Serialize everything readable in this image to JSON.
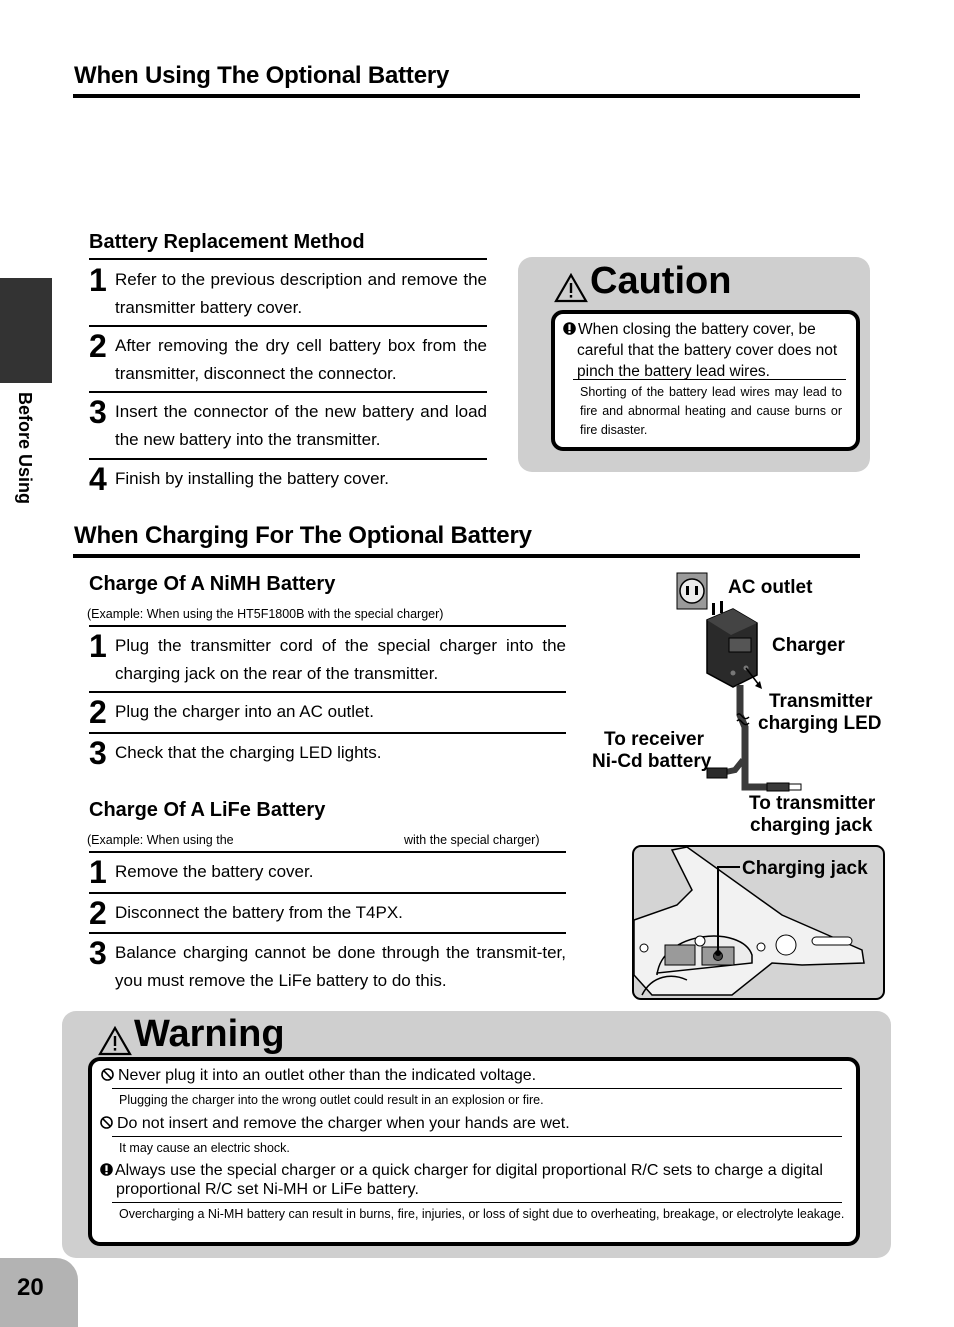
{
  "section_using": {
    "title": "When Using The Optional Battery",
    "replacement": {
      "title": "Battery Replacement Method",
      "steps": [
        {
          "num": "1",
          "text": "Refer to the previous description and remove the transmitter battery cover."
        },
        {
          "num": "2",
          "text": "After removing the dry cell battery box from the transmitter, disconnect the connector."
        },
        {
          "num": "3",
          "text": "Insert the connector of the new battery and load the new battery into the transmitter."
        },
        {
          "num": "4",
          "text": "Finish by installing the battery cover."
        }
      ]
    },
    "caution": {
      "title": "Caution",
      "main": "When closing the battery cover, be careful that the battery cover does not pinch the battery lead wires.",
      "sub": "Shorting of the battery lead wires may lead to fire and abnormal heating and cause burns or fire disaster."
    }
  },
  "side_tab": {
    "label": "Before Using"
  },
  "section_charging": {
    "title": "When Charging For The Optional Battery",
    "nimh": {
      "title": "Charge Of A NiMH Battery",
      "example": "(Example: When using the HT5F1800B with the special charger)",
      "steps": [
        {
          "num": "1",
          "text": "Plug the transmitter cord of the special charger into the charging jack on the rear of the transmitter."
        },
        {
          "num": "2",
          "text": "Plug the charger into an AC outlet."
        },
        {
          "num": "3",
          "text": "Check that the charging LED lights."
        }
      ]
    },
    "life": {
      "title": "Charge Of A LiFe Battery",
      "example_start": "(Example: When using the",
      "example_end": "with the special charger)",
      "steps": [
        {
          "num": "1",
          "text": "Remove the battery cover."
        },
        {
          "num": "2",
          "text": "Disconnect the battery from the T4PX."
        },
        {
          "num": "3",
          "text": "Balance charging cannot be done through the transmit-ter, you must remove the LiFe battery to do this."
        }
      ]
    },
    "diagram": {
      "ac_outlet": "AC outlet",
      "charger": "Charger",
      "tx_led_1": "Transmitter",
      "tx_led_2": "charging LED",
      "receiver_1": "To receiver",
      "receiver_2": "Ni-Cd battery",
      "tx_jack_1": "To transmitter",
      "tx_jack_2": "charging jack",
      "charging_jack": "Charging jack"
    }
  },
  "warning": {
    "title": "Warning",
    "items": [
      {
        "icon": "prohibited-icon",
        "main": "Never plug it into an outlet other than the indicated voltage.",
        "sub": "Plugging the charger into the wrong outlet could result in an explosion or fire."
      },
      {
        "icon": "prohibited-icon",
        "main": "Do not insert and remove the charger when your hands are wet.",
        "sub": "It may cause an electric shock."
      },
      {
        "icon": "exclamation-icon",
        "main": "Always use the special charger or a quick charger for digital proportional R/C sets to charge a digital proportional R/C set Ni-MH or LiFe battery.",
        "sub": "Overcharging a Ni-MH battery can result in burns, fire, injuries, or loss of sight due to overheating, breakage, or electrolyte leakage."
      }
    ]
  },
  "page": {
    "number": "20"
  },
  "colors": {
    "panel_gray": "#cfcfcf",
    "side_tab": "#333333",
    "page_tab": "#b3b3b3"
  }
}
